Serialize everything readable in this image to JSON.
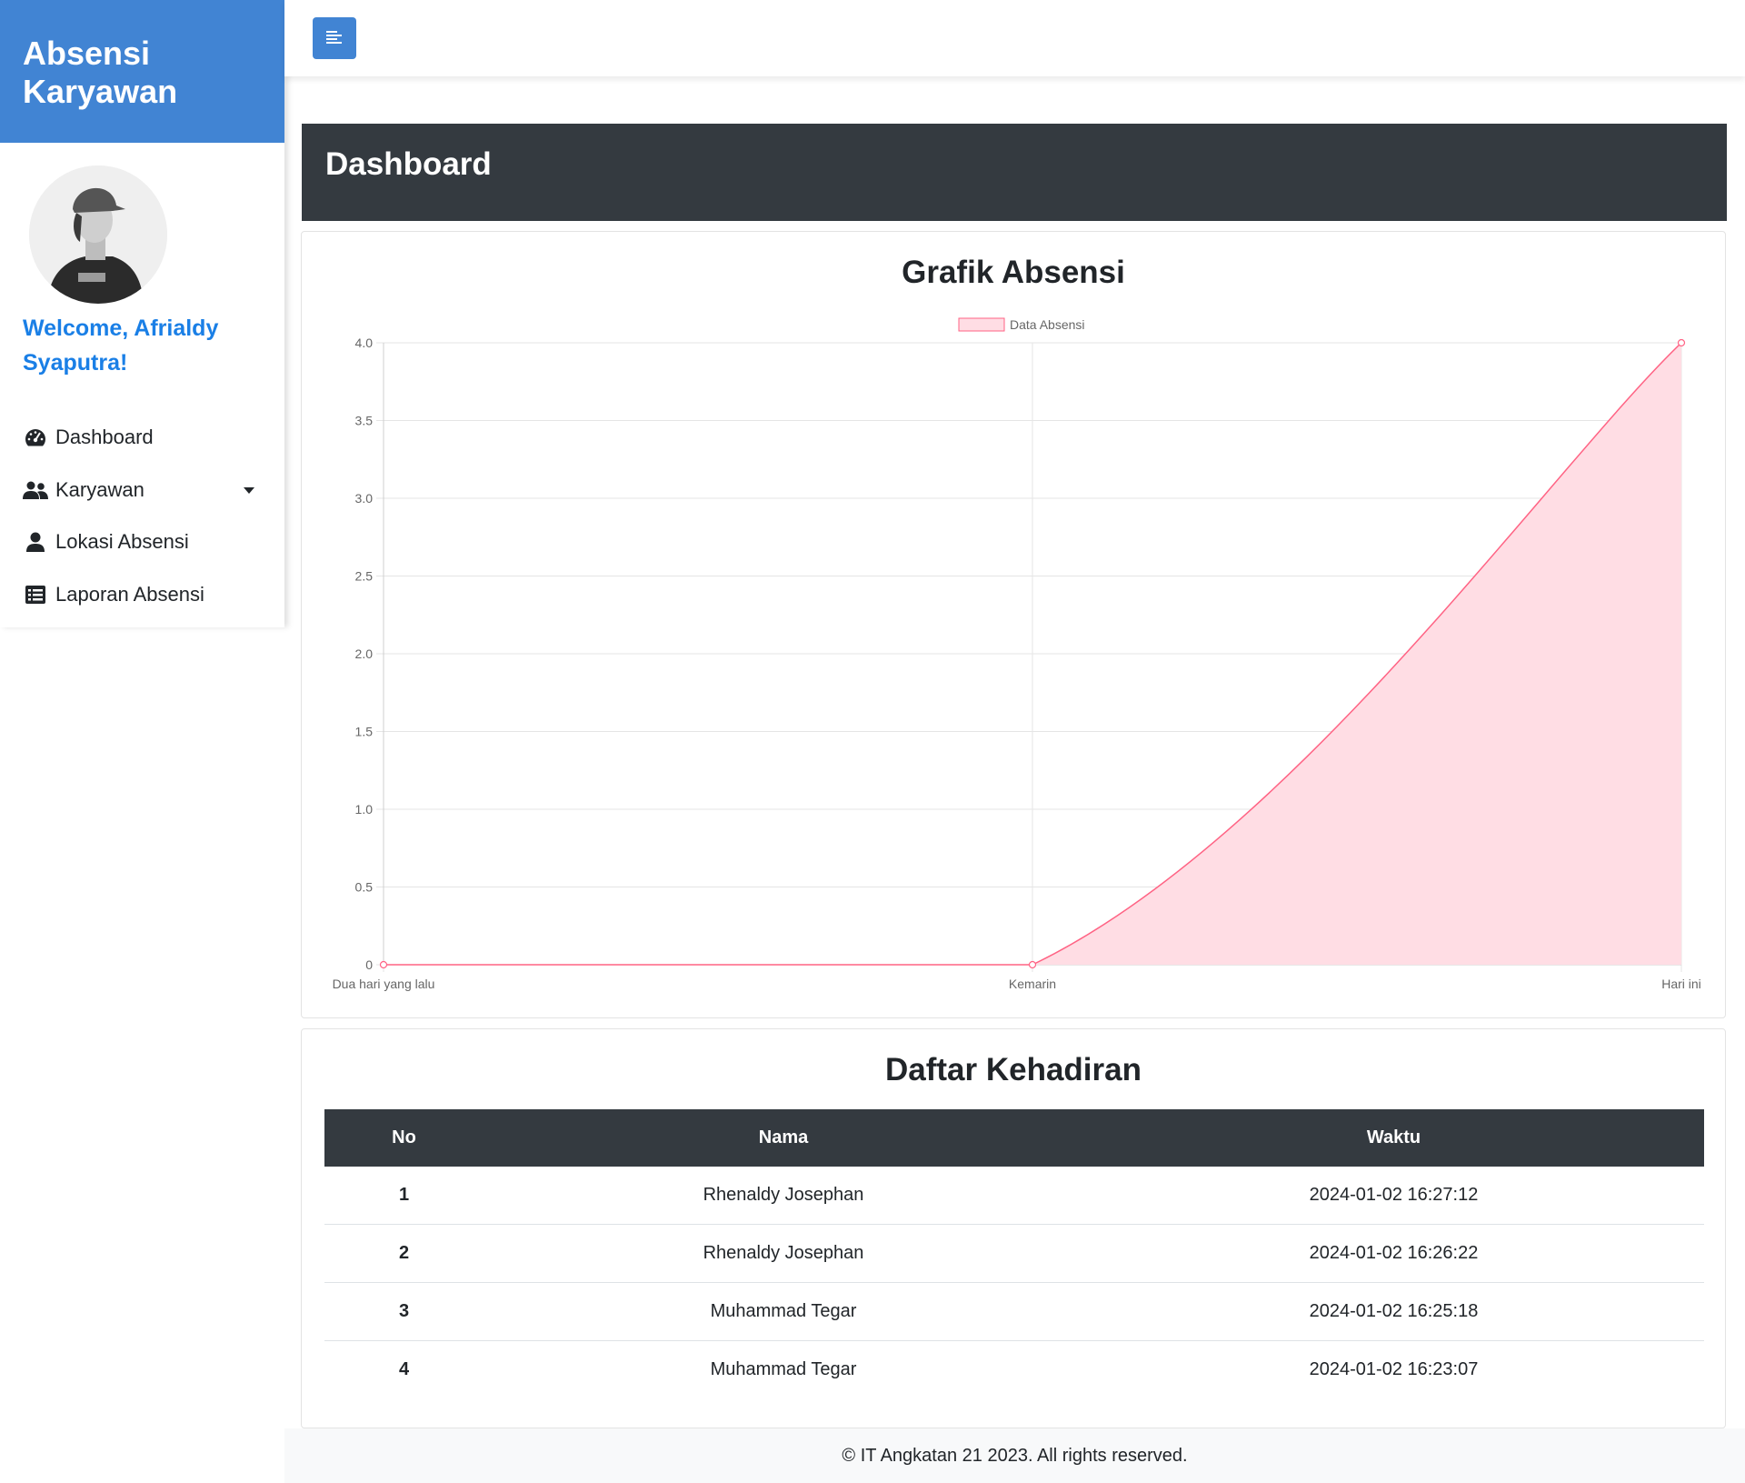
{
  "sidebar": {
    "brand": "Absensi Karyawan",
    "welcome": "Welcome, Afrialdy Syaputra!",
    "items": [
      {
        "label": "Dashboard",
        "icon": "tachometer-icon"
      },
      {
        "label": "Karyawan",
        "icon": "users-icon",
        "has_dropdown": true
      },
      {
        "label": "Lokasi Absensi",
        "icon": "user-icon"
      },
      {
        "label": "Laporan Absensi",
        "icon": "list-icon"
      }
    ]
  },
  "topbar": {
    "toggle_icon": "menu-align-left-icon"
  },
  "header": {
    "title": "Dashboard"
  },
  "chart_card": {
    "title": "Grafik Absensi"
  },
  "chart_data": {
    "type": "area",
    "title": "Grafik Absensi",
    "categories": [
      "Dua hari yang lalu",
      "Kemarin",
      "Hari ini"
    ],
    "series": [
      {
        "name": "Data Absensi",
        "values": [
          0,
          0,
          4
        ],
        "color": "#ff6384",
        "fill": "#ffdde4"
      }
    ],
    "ylim": [
      0,
      4
    ],
    "yticks": [
      "0",
      "0.5",
      "1.0",
      "1.5",
      "2.0",
      "2.5",
      "3.0",
      "3.5",
      "4.0"
    ],
    "grid": true,
    "legend": "top-center"
  },
  "table_card": {
    "title": "Daftar Kehadiran",
    "columns": [
      "No",
      "Nama",
      "Waktu"
    ],
    "rows": [
      {
        "no": "1",
        "nama": "Rhenaldy Josephan",
        "waktu": "2024-01-02 16:27:12"
      },
      {
        "no": "2",
        "nama": "Rhenaldy Josephan",
        "waktu": "2024-01-02 16:26:22"
      },
      {
        "no": "3",
        "nama": "Muhammad Tegar",
        "waktu": "2024-01-02 16:25:18"
      },
      {
        "no": "4",
        "nama": "Muhammad Tegar",
        "waktu": "2024-01-02 16:23:07"
      }
    ]
  },
  "footer": {
    "text": "© IT Angkatan 21 2023. All rights reserved."
  },
  "colors": {
    "brand": "#4184d3",
    "welcome": "#1a7fe6",
    "dark": "#343a40"
  }
}
